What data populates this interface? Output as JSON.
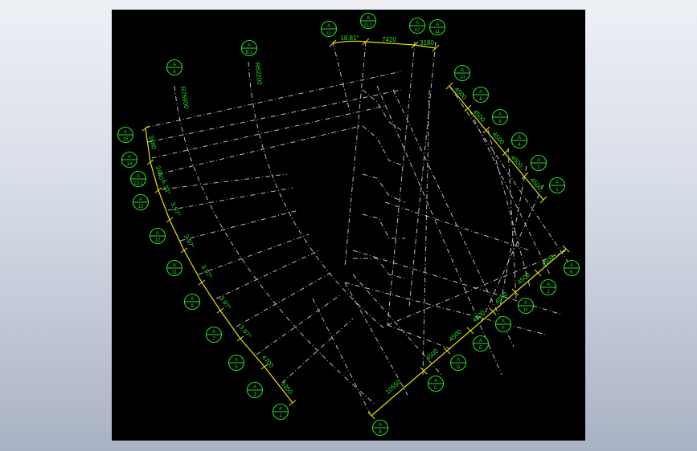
{
  "drawing": {
    "background": "#000000",
    "grid_color": "#bdbdbd",
    "dimension_color": "#e8e800",
    "bubble_color": "#22e022",
    "bubbles": [
      {
        "id": "bubble-A-15",
        "top": "A",
        "bottom": "15"
      },
      {
        "id": "bubble-A-14",
        "top": "A",
        "bottom": "14"
      },
      {
        "id": "bubble-A-13-1",
        "top": "A",
        "bottom": "13.1"
      },
      {
        "id": "bubble-A-13",
        "top": "A",
        "bottom": "13"
      },
      {
        "id": "bubble-A-12",
        "top": "A",
        "bottom": "12"
      },
      {
        "id": "bubble-A-11",
        "top": "A",
        "bottom": "11"
      },
      {
        "id": "bubble-A-9",
        "top": "A",
        "bottom": "9"
      },
      {
        "id": "bubble-A-7",
        "top": "A",
        "bottom": "7"
      },
      {
        "id": "bubble-A-5",
        "top": "A",
        "bottom": "5"
      },
      {
        "id": "bubble-A-3",
        "top": "A",
        "bottom": "3"
      },
      {
        "id": "bubble-A-1-left",
        "top": "A",
        "bottom": "1"
      },
      {
        "id": "bubble-A-A",
        "top": "A",
        "bottom": "A"
      },
      {
        "id": "bubble-A-B-1",
        "top": "A",
        "bottom": "B.1"
      },
      {
        "id": "bubble-A-G",
        "top": "A",
        "bottom": "G"
      },
      {
        "id": "bubble-A-G-1",
        "top": "A",
        "bottom": "G.1"
      },
      {
        "id": "bubble-A-12-top",
        "top": "A",
        "bottom": "12"
      },
      {
        "id": "bubble-A-11-top",
        "top": "A",
        "bottom": "11"
      },
      {
        "id": "bubble-A-10",
        "top": "A",
        "bottom": "10"
      },
      {
        "id": "bubble-A-8",
        "top": "A",
        "bottom": "8"
      },
      {
        "id": "bubble-A-6",
        "top": "A",
        "bottom": "6"
      },
      {
        "id": "bubble-A-4",
        "top": "A",
        "bottom": "4"
      },
      {
        "id": "bubble-A-2",
        "top": "A",
        "bottom": "2"
      },
      {
        "id": "bubble-A-1-right",
        "top": "A",
        "bottom": "1"
      },
      {
        "id": "bubble-A-K",
        "top": "A",
        "bottom": "K"
      },
      {
        "id": "bubble-A-J",
        "top": "A",
        "bottom": "J"
      },
      {
        "id": "bubble-A-H",
        "top": "A",
        "bottom": "H"
      },
      {
        "id": "bubble-A-F",
        "top": "A",
        "bottom": "F"
      },
      {
        "id": "bubble-A-E",
        "top": "A",
        "bottom": "E"
      },
      {
        "id": "bubble-A-D",
        "top": "A",
        "bottom": "D"
      },
      {
        "id": "bubble-A-C",
        "top": "A",
        "bottom": "C"
      },
      {
        "id": "bubble-A-B",
        "top": "A",
        "bottom": "B"
      }
    ],
    "dimensions": {
      "left": [
        "3880",
        "3440",
        "6.33°",
        "3.97°",
        "3.97°",
        "3.97°",
        "3.97°",
        "3.97°",
        "4700",
        "5350"
      ],
      "top": [
        "18.81°",
        "7420",
        "3180"
      ],
      "right_upper": [
        "4500",
        "4500",
        "4500",
        "4500",
        "4500"
      ],
      "right_lower": [
        "10550",
        "4500",
        "4500",
        "4500",
        "4500",
        "4500",
        "4500"
      ],
      "radius_outer": "R75900",
      "radius_inner": "R62200"
    }
  }
}
